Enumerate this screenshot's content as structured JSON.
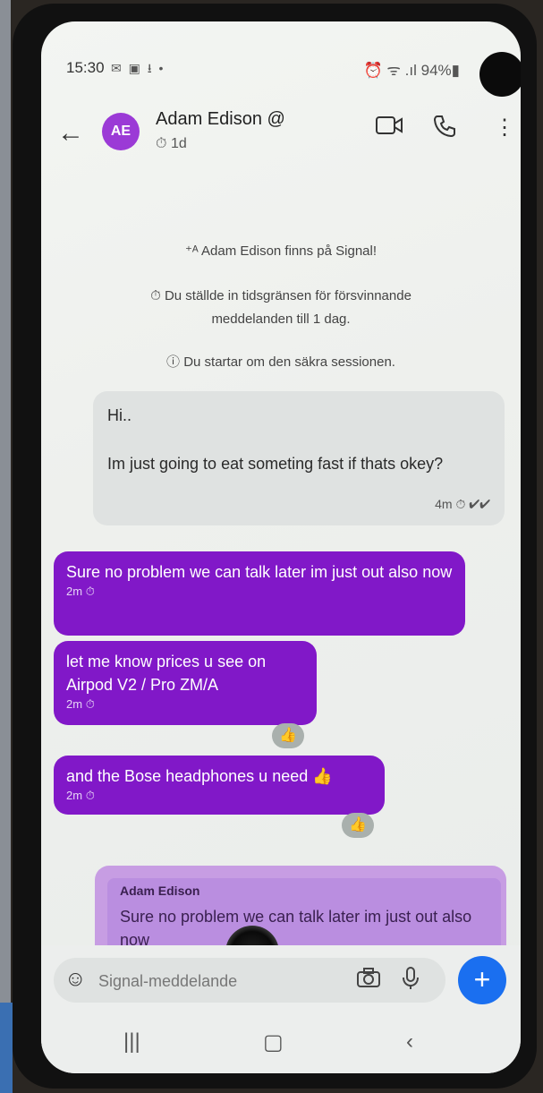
{
  "status": {
    "time": "15:30",
    "left_icons": "✉ ▣ ⭳ •",
    "right": "⏰ ᯤ .ıl 94%▮"
  },
  "header": {
    "avatar": "AE",
    "name": "Adam Edison",
    "name_suffix": "@",
    "timer": "1d",
    "icons": [
      "back-arrow-icon",
      "video-call-icon",
      "phone-call-icon",
      "more-options-icon"
    ]
  },
  "system_messages": [
    "Adam Edison finns på Signal!",
    "Du ställde in tidsgränsen för försvinnande meddelanden till 1 dag.",
    "Du startar om den säkra sessionen."
  ],
  "messages": [
    {
      "direction": "incoming",
      "text": "Hi..\n\nIm just going to eat someting fast  if thats okey?",
      "time": "4m"
    },
    {
      "direction": "outgoing",
      "text": "Sure no problem we can talk later im just out also now",
      "time": "2m"
    },
    {
      "direction": "outgoing",
      "text": "let me know prices u see on Airpod V2 / Pro ZM/A",
      "time": "2m",
      "reaction": "👍"
    },
    {
      "direction": "outgoing",
      "text": "and the Bose headphones u need 👍",
      "time": "2m",
      "reaction": "👍"
    }
  ],
  "quote": {
    "author": "Adam Edison",
    "text": "Sure no problem we can talk later im just out also now"
  },
  "composer": {
    "placeholder": "Signal-meddelande"
  },
  "colors": {
    "outgoing_bubble": "#8118c8",
    "incoming_bubble": "#dfe2e1",
    "avatar": "#9b3ad6",
    "send_button": "#1a6ff0"
  }
}
